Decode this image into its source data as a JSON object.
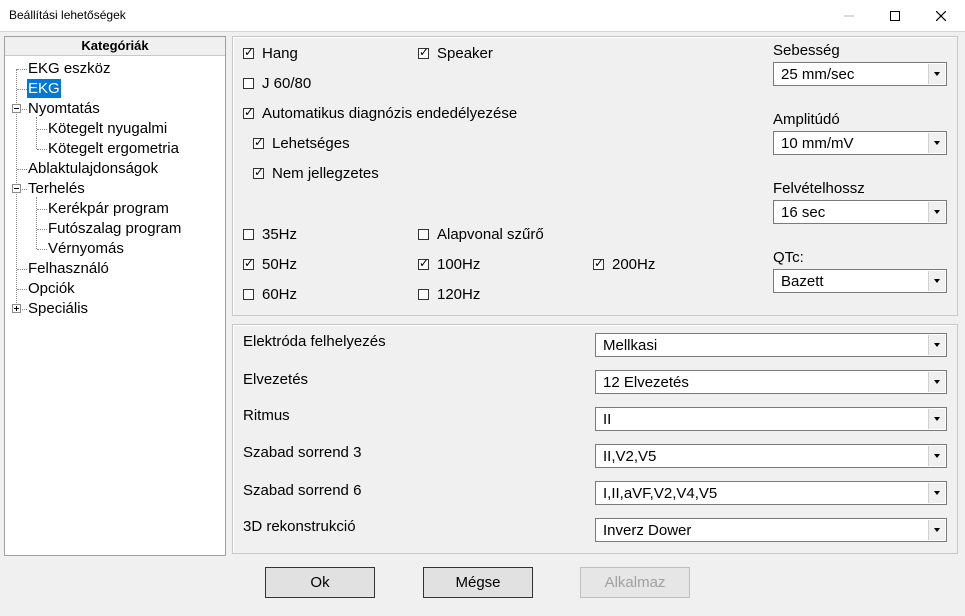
{
  "window": {
    "title": "Beállítási lehetőségek"
  },
  "tree": {
    "header": "Kategóriák",
    "items": [
      {
        "label": "EKG eszköz"
      },
      {
        "label": "EKG",
        "selected": true
      },
      {
        "label": "Nyomtatás",
        "expanded": true
      },
      {
        "label": "Kötegelt nyugalmi"
      },
      {
        "label": "Kötegelt ergometria"
      },
      {
        "label": "Ablaktulajdonságok"
      },
      {
        "label": "Terhelés",
        "expanded": true
      },
      {
        "label": "Kerékpár program"
      },
      {
        "label": "Futószalag program"
      },
      {
        "label": "Vérnyomás"
      },
      {
        "label": "Felhasználó"
      },
      {
        "label": "Opciók"
      },
      {
        "label": "Speciális",
        "expanded": false
      }
    ]
  },
  "top": {
    "hang": {
      "label": "Hang",
      "checked": true
    },
    "speaker": {
      "label": "Speaker",
      "checked": true
    },
    "j6080": {
      "label": "J 60/80",
      "checked": false
    },
    "auto": {
      "label": "Automatikus diagnózis endedélyezése",
      "checked": true
    },
    "lehetseges": {
      "label": "Lehetséges",
      "checked": true
    },
    "nemjell": {
      "label": "Nem jellegzetes",
      "checked": true
    },
    "hz35": {
      "label": "35Hz",
      "checked": false
    },
    "alapvonal": {
      "label": "Alapvonal szűrő",
      "checked": false
    },
    "hz50": {
      "label": "50Hz",
      "checked": true
    },
    "hz100": {
      "label": "100Hz",
      "checked": true
    },
    "hz200": {
      "label": "200Hz",
      "checked": true
    },
    "hz60": {
      "label": "60Hz",
      "checked": false
    },
    "hz120": {
      "label": "120Hz",
      "checked": false
    },
    "sebesseg": {
      "label": "Sebesség",
      "value": "25 mm/sec"
    },
    "amplitudo": {
      "label": "Amplitúdó",
      "value": "10 mm/mV"
    },
    "felvetel": {
      "label": "Felvételhossz",
      "value": "16 sec"
    },
    "qtc": {
      "label": "QTc:",
      "value": "Bazett"
    }
  },
  "bottom": {
    "rows": [
      {
        "label": "Elektróda felhelyezés",
        "value": "Mellkasi"
      },
      {
        "label": "Elvezetés",
        "value": "12 Elvezetés"
      },
      {
        "label": "Ritmus",
        "value": "II"
      },
      {
        "label": "Szabad sorrend 3",
        "value": "II,V2,V5"
      },
      {
        "label": "Szabad sorrend 6",
        "value": "I,II,aVF,V2,V4,V5"
      },
      {
        "label": "3D rekonstrukció",
        "value": "Inverz Dower"
      }
    ]
  },
  "buttons": {
    "ok": "Ok",
    "cancel": "Mégse",
    "apply": "Alkalmaz"
  }
}
